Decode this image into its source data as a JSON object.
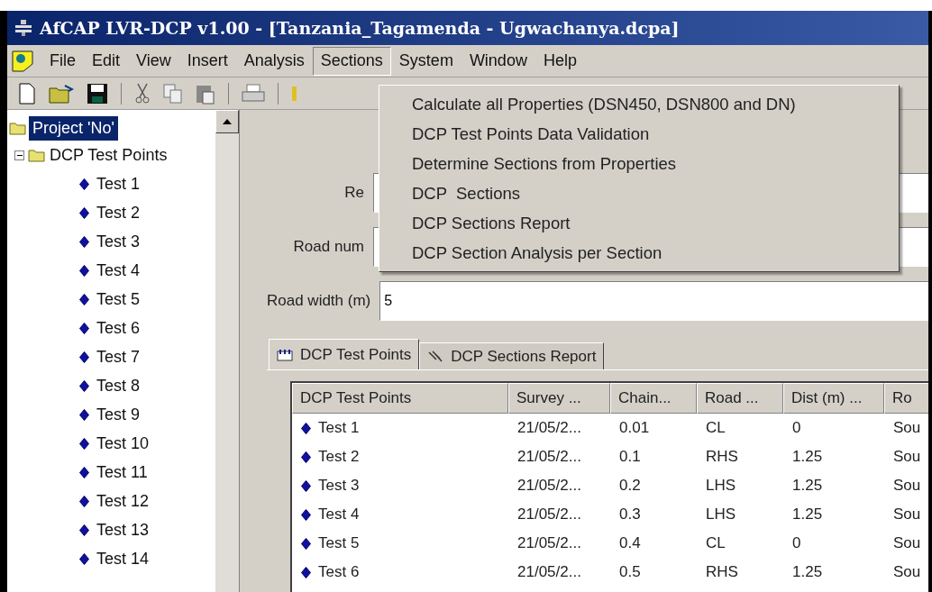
{
  "window": {
    "title": "AfCAP LVR-DCP v1.00  - [Tanzania_Tagamenda - Ugwachanya.dcpa]"
  },
  "menu_bar": [
    {
      "label": "File",
      "selected": false
    },
    {
      "label": "Edit",
      "selected": false
    },
    {
      "label": "View",
      "selected": false
    },
    {
      "label": "Insert",
      "selected": false
    },
    {
      "label": "Analysis",
      "selected": false
    },
    {
      "label": "Sections",
      "selected": true
    },
    {
      "label": "System",
      "selected": false
    },
    {
      "label": "Window",
      "selected": false
    },
    {
      "label": "Help",
      "selected": false
    }
  ],
  "open_menu": {
    "items": [
      "Calculate all Properties (DSN450, DSN800 and DN)",
      "DCP Test Points Data Validation",
      "Determine Sections from Properties",
      "DCP  Sections",
      "DCP Sections Report",
      "DCP Section Analysis per Section"
    ]
  },
  "tree": {
    "root": {
      "label": "Project 'No'",
      "selected": true,
      "children": [
        {
          "label": "DCP Test Points",
          "expanded": true,
          "children": [
            {
              "label": "Test 1"
            },
            {
              "label": "Test 2"
            },
            {
              "label": "Test 3"
            },
            {
              "label": "Test 4"
            },
            {
              "label": "Test 5"
            },
            {
              "label": "Test 6"
            },
            {
              "label": "Test 7"
            },
            {
              "label": "Test 8"
            },
            {
              "label": "Test 9"
            },
            {
              "label": "Test 10"
            },
            {
              "label": "Test 11"
            },
            {
              "label": "Test 12"
            },
            {
              "label": "Test 13"
            },
            {
              "label": "Test 14"
            }
          ]
        }
      ]
    }
  },
  "form": [
    {
      "label": "Re"
    },
    {
      "label": "Road num"
    },
    {
      "label": "Road width (m)",
      "value": "5"
    }
  ],
  "tabs": [
    {
      "label": "DCP Test Points",
      "selected": true
    },
    {
      "label": "DCP Sections Report",
      "selected": false
    }
  ],
  "table": {
    "columns": [
      "DCP Test Points",
      "Survey ...",
      "Chain...",
      "Road ...",
      "Dist (m) ...",
      "Ro"
    ],
    "rows": [
      [
        "Test 1",
        "21/05/2...",
        "0.01",
        "CL",
        "0",
        "Sou"
      ],
      [
        "Test 2",
        "21/05/2...",
        "0.1",
        "RHS",
        "1.25",
        "Sou"
      ],
      [
        "Test 3",
        "21/05/2...",
        "0.2",
        "LHS",
        "1.25",
        "Sou"
      ],
      [
        "Test 4",
        "21/05/2...",
        "0.3",
        "LHS",
        "1.25",
        "Sou"
      ],
      [
        "Test 5",
        "21/05/2...",
        "0.4",
        "CL",
        "0",
        "Sou"
      ],
      [
        "Test 6",
        "21/05/2...",
        "0.5",
        "RHS",
        "1.25",
        "Sou"
      ]
    ]
  }
}
